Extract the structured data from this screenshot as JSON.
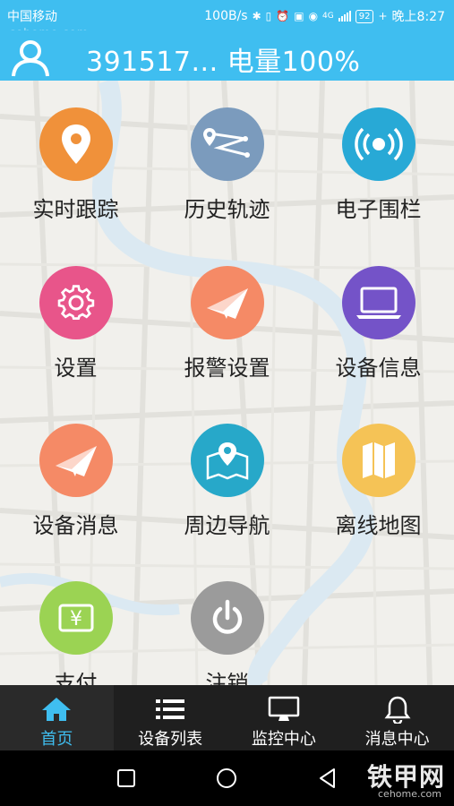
{
  "status_bar": {
    "carrier": "中国移动",
    "speed": "100B/s",
    "network_type": "4G",
    "battery": "92",
    "time": "晚上8:27",
    "watermark": "cehome.com"
  },
  "header": {
    "title": "391517... 电量100%"
  },
  "menu": {
    "items": [
      {
        "label": "实时跟踪",
        "icon": "location-pin-icon",
        "color": "#f0913a"
      },
      {
        "label": "历史轨迹",
        "icon": "route-icon",
        "color": "#7b9bbd"
      },
      {
        "label": "电子围栏",
        "icon": "broadcast-icon",
        "color": "#28a9d6"
      },
      {
        "label": "设置",
        "icon": "gear-icon",
        "color": "#e8558a"
      },
      {
        "label": "报警设置",
        "icon": "envelope-icon",
        "color": "#f58a66"
      },
      {
        "label": "设备信息",
        "icon": "laptop-icon",
        "color": "#7453c8"
      },
      {
        "label": "设备消息",
        "icon": "envelope-icon",
        "color": "#f58a66"
      },
      {
        "label": "周边导航",
        "icon": "map-pin-icon",
        "color": "#27a8c9"
      },
      {
        "label": "离线地图",
        "icon": "folded-map-icon",
        "color": "#f5c356"
      },
      {
        "label": "支付",
        "icon": "yuan-icon",
        "color": "#9bd353"
      },
      {
        "label": "注销",
        "icon": "power-icon",
        "color": "#9b9b9b"
      }
    ]
  },
  "bottom_nav": {
    "items": [
      {
        "label": "首页",
        "icon": "home-icon",
        "active": true
      },
      {
        "label": "设备列表",
        "icon": "list-icon",
        "active": false
      },
      {
        "label": "监控中心",
        "icon": "monitor-icon",
        "active": false
      },
      {
        "label": "消息中心",
        "icon": "bell-icon",
        "active": false
      }
    ],
    "accent": "#3fbef0"
  },
  "system_nav": {
    "watermark": "铁甲网",
    "watermark_sub": "cehome.com"
  }
}
